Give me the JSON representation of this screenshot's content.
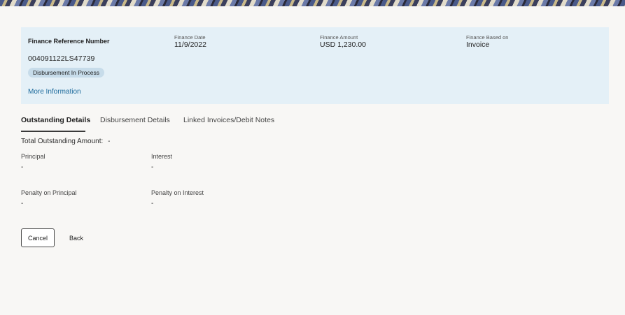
{
  "summary": {
    "reference_label": "Finance Reference Number",
    "reference_value": "004091122LS47739",
    "status": "Disbursement In Process",
    "more_info": "More Information",
    "finance_date_label": "Finance Date",
    "finance_date_value": "11/9/2022",
    "finance_amount_label": "Finance Amount",
    "finance_amount_value": "USD 1,230.00",
    "finance_based_label": "Finance Based on",
    "finance_based_value": "Invoice"
  },
  "tabs": [
    {
      "label": "Outstanding Details",
      "active": true
    },
    {
      "label": "Disbursement Details",
      "active": false
    },
    {
      "label": "Linked Invoices/Debit Notes",
      "active": false
    }
  ],
  "outstanding": {
    "total_label": "Total Outstanding Amount:",
    "total_value": "-",
    "principal_label": "Principal",
    "principal_value": "-",
    "interest_label": "Interest",
    "interest_value": "-",
    "penalty_principal_label": "Penalty on Principal",
    "penalty_principal_value": "-",
    "penalty_interest_label": "Penalty on Interest",
    "penalty_interest_value": "-"
  },
  "actions": {
    "cancel": "Cancel",
    "back": "Back"
  }
}
